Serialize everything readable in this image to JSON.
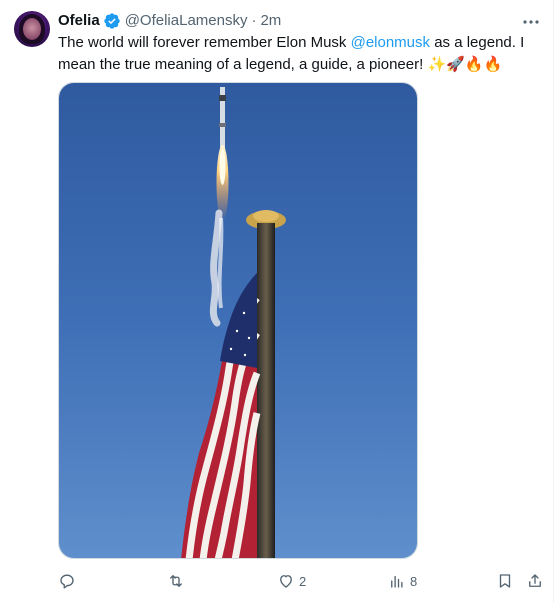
{
  "post": {
    "author": {
      "name": "Ofelia",
      "handle": "@OfeliaLamensky",
      "separator": "·",
      "time": "2m",
      "verified": true
    },
    "text": {
      "part1": "The world will forever remember Elon Musk ",
      "mention": "@elonmusk",
      "part2": " as a legend. I mean the true meaning of a legend, a guide, a pioneer! ",
      "emojis": "✨🚀🔥🔥"
    },
    "media": {
      "description_icon": "rocket-launch-flag-photo"
    },
    "actions": {
      "reply_count": "",
      "repost_count": "",
      "like_count": "2",
      "views_count": "8"
    },
    "colors": {
      "accent": "#1d9bf0",
      "secondary_text": "#536471",
      "sky_top": "#2f5aa0",
      "sky_bottom": "#5f8fcc"
    }
  }
}
